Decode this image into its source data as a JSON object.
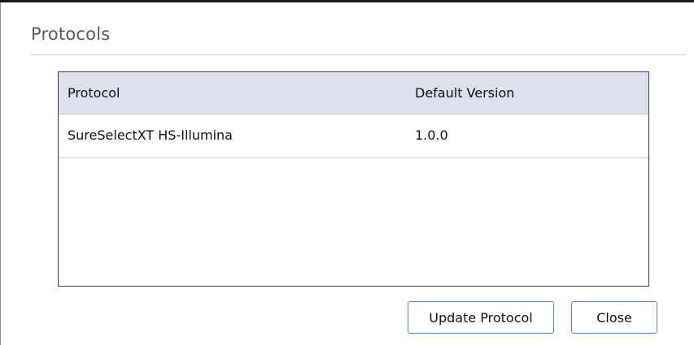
{
  "dialog": {
    "title": "Protocols"
  },
  "table": {
    "columns": [
      "Protocol",
      "Default Version"
    ],
    "rows": [
      {
        "protocol": "SureSelectXT HS-Illumina",
        "default_version": "1.0.0"
      }
    ]
  },
  "buttons": {
    "update_label": "Update Protocol",
    "close_label": "Close"
  },
  "colors": {
    "header_background": "#dfe0ed",
    "button_border": "#5b87c9",
    "title_text": "#555a61"
  }
}
